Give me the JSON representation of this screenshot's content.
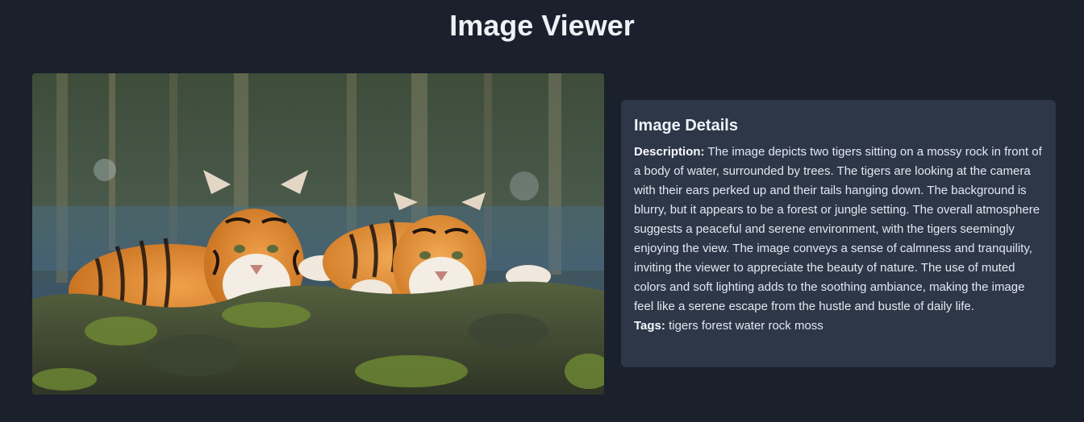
{
  "page": {
    "title": "Image Viewer"
  },
  "image": {
    "icon": "tigers-photo"
  },
  "details": {
    "heading": "Image Details",
    "description_label": "Description:",
    "description": "The image depicts two tigers sitting on a mossy rock in front of a body of water, surrounded by trees. The tigers are looking at the camera with their ears perked up and their tails hanging down. The background is blurry, but it appears to be a forest or jungle setting. The overall atmosphere suggests a peaceful and serene environment, with the tigers seemingly enjoying the view. The image conveys a sense of calmness and tranquility, inviting the viewer to appreciate the beauty of nature. The use of muted colors and soft lighting adds to the soothing ambiance, making the image feel like a serene escape from the hustle and bustle of daily life.",
    "tags_label": "Tags:",
    "tags": "tigers forest water rock moss"
  },
  "colors": {
    "background": "#1a202c",
    "panel": "#2d3748",
    "text": "#edf2f7"
  }
}
